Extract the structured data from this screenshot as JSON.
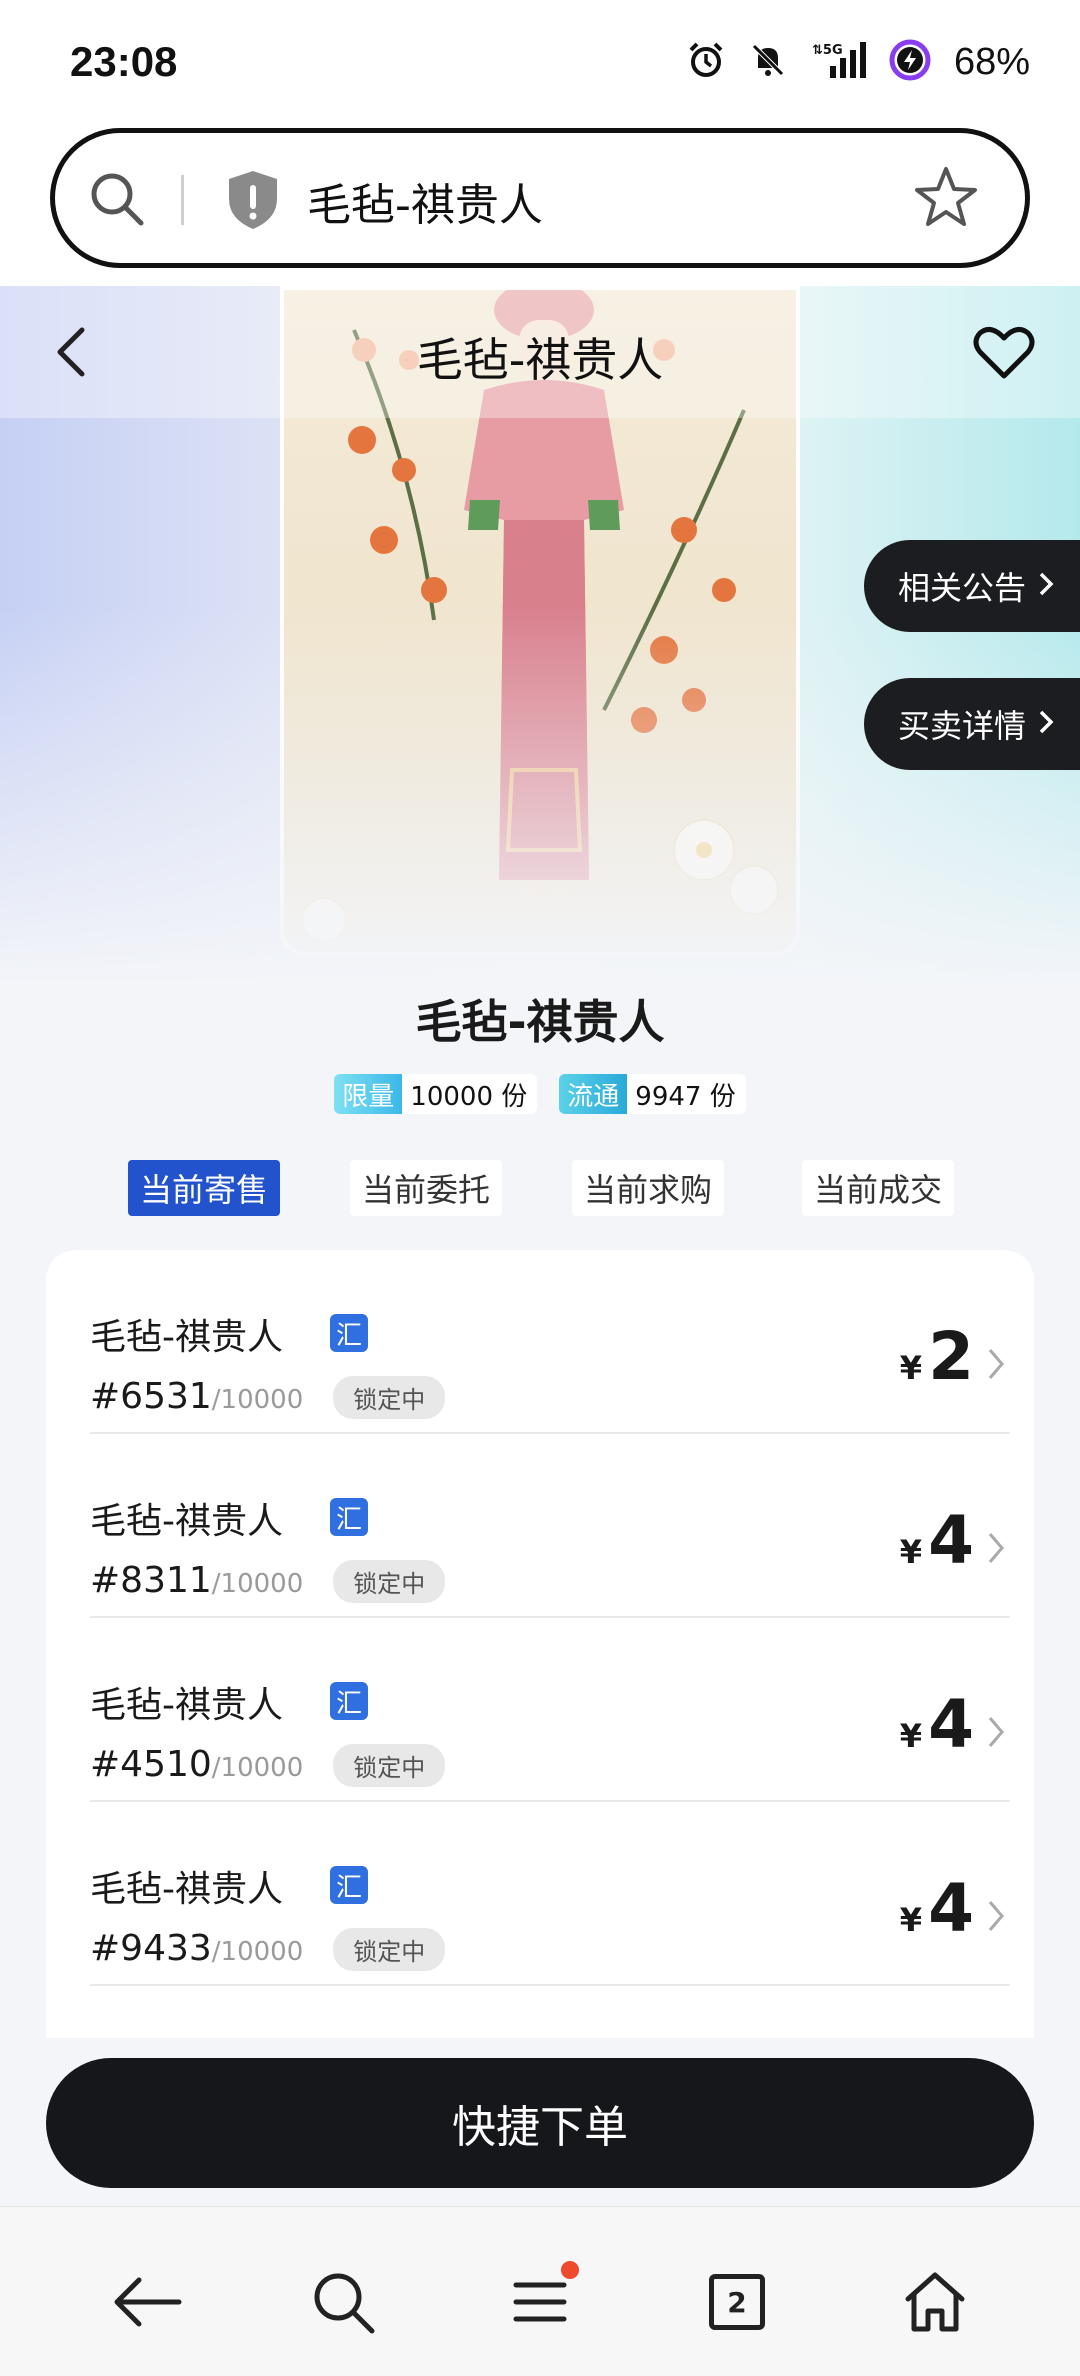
{
  "status_bar": {
    "time": "23:08",
    "battery_text": "68%",
    "network": "5G",
    "icons": [
      "alarm-icon",
      "bell-off-icon",
      "signal-5g-icon",
      "battery-charging-icon"
    ]
  },
  "address_bar": {
    "title": "毛毡-祺贵人",
    "icons": [
      "search-icon",
      "shield-warning-icon",
      "star-icon"
    ]
  },
  "hero": {
    "title": "毛毡-祺贵人",
    "side_buttons": [
      {
        "label": "相关公告"
      },
      {
        "label": "买卖详情"
      }
    ]
  },
  "item": {
    "name": "毛毡-祺贵人",
    "stats": [
      {
        "tag": "限量",
        "value": "10000 份"
      },
      {
        "tag": "流通",
        "value": "9947 份"
      }
    ]
  },
  "tabs": [
    {
      "label": "当前寄售",
      "active": true
    },
    {
      "label": "当前委托",
      "active": false
    },
    {
      "label": "当前求购",
      "active": false
    },
    {
      "label": "当前成交",
      "active": false
    }
  ],
  "listings": [
    {
      "name": "毛毡-祺贵人",
      "badge": "汇",
      "serial": "#6531",
      "total": "/10000",
      "status": "锁定中",
      "currency": "¥",
      "price": "2"
    },
    {
      "name": "毛毡-祺贵人",
      "badge": "汇",
      "serial": "#8311",
      "total": "/10000",
      "status": "锁定中",
      "currency": "¥",
      "price": "4"
    },
    {
      "name": "毛毡-祺贵人",
      "badge": "汇",
      "serial": "#4510",
      "total": "/10000",
      "status": "锁定中",
      "currency": "¥",
      "price": "4"
    },
    {
      "name": "毛毡-祺贵人",
      "badge": "汇",
      "serial": "#9433",
      "total": "/10000",
      "status": "锁定中",
      "currency": "¥",
      "price": "4"
    }
  ],
  "quick_order": {
    "label": "快捷下单"
  },
  "browser_nav": {
    "tab_count": "2",
    "icons": [
      "back-arrow-icon",
      "search-icon",
      "menu-icon",
      "tabs-icon",
      "home-icon"
    ],
    "menu_notification_color": "#f04a2c"
  },
  "colors": {
    "active_tab": "#2253cc",
    "badge": "#2f6fe0",
    "dark_button": "#16171b"
  }
}
